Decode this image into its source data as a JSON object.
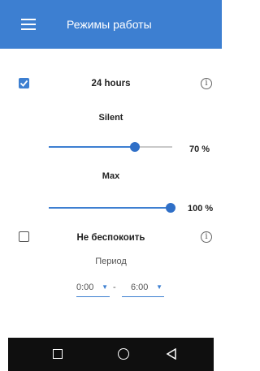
{
  "app_bar": {
    "title": "Режимы работы",
    "menu_icon": "hamburger-menu-icon"
  },
  "mode_24h": {
    "checked": true,
    "title": "24 hours",
    "info_glyph": "i",
    "silent": {
      "label": "Silent",
      "value_label": "70 %",
      "value_fraction": 0.7
    },
    "max": {
      "label": "Max",
      "value_label": "100 %",
      "value_fraction": 1.0
    }
  },
  "do_not_disturb": {
    "checked": false,
    "title": "Не беспокоить",
    "info_glyph": "i",
    "period_label": "Период",
    "from": "0:00",
    "to": "6:00",
    "separator": "-"
  },
  "nav_bar": {
    "icons": [
      "square-icon",
      "circle-icon",
      "triangle-back-icon"
    ]
  },
  "colors": {
    "accent": "#3d7fd1",
    "nav_bar": "#0f0f0f"
  }
}
